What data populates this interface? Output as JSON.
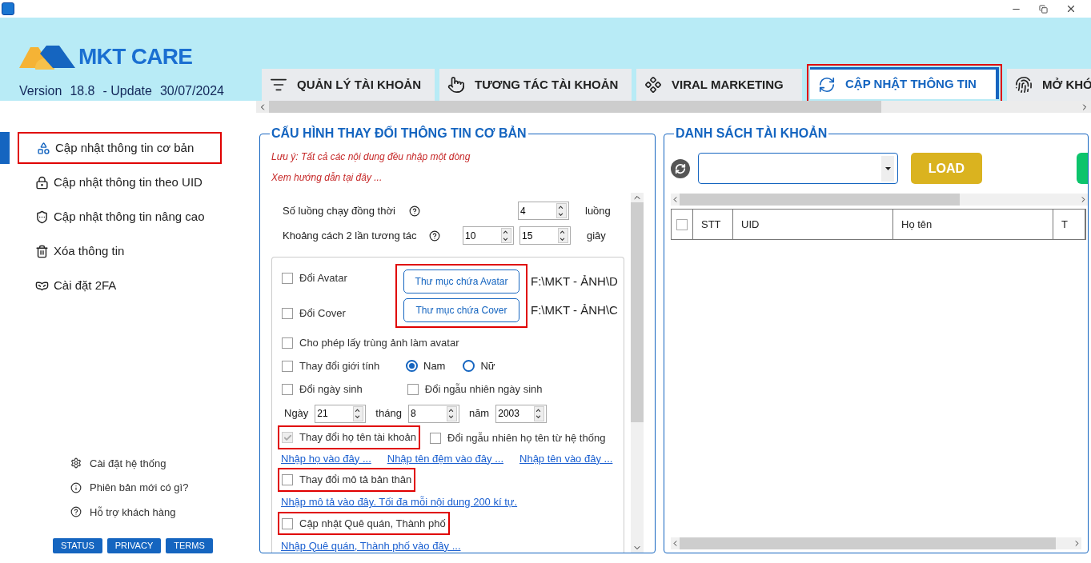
{
  "app": {
    "logo_text": "MKT CARE",
    "version_label": "Version",
    "version": "18.8",
    "update_label": "- Update",
    "update_date": "30/07/2024"
  },
  "tabs": [
    {
      "label": "QUẢN LÝ TÀI KHOẢN",
      "selected": false,
      "highlighted": false
    },
    {
      "label": "TƯƠNG TÁC TÀI KHOẢN",
      "selected": false,
      "highlighted": false
    },
    {
      "label": "VIRAL MARKETING",
      "selected": false,
      "highlighted": false
    },
    {
      "label": "CẬP NHẬT THÔNG TIN",
      "selected": true,
      "highlighted": true
    },
    {
      "label": "MỞ KHÓ",
      "selected": false,
      "highlighted": false
    }
  ],
  "sidebar": {
    "items": [
      {
        "label": "Cập nhật thông tin cơ bản",
        "selected": true,
        "highlighted": true
      },
      {
        "label": "Cập nhật thông tin theo UID",
        "selected": false,
        "highlighted": false
      },
      {
        "label": "Cập nhật thông tin nâng cao",
        "selected": false,
        "highlighted": false
      },
      {
        "label": "Xóa thông tin",
        "selected": false,
        "highlighted": false
      },
      {
        "label": "Cài đặt 2FA",
        "selected": false,
        "highlighted": false
      }
    ],
    "links": [
      "Cài đặt hệ thống",
      "Phiên bản mới có gì?",
      "Hỗ trợ khách hàng"
    ],
    "buttons": [
      "STATUS",
      "PRIVACY",
      "TERMS"
    ]
  },
  "config": {
    "title": "CẤU HÌNH THAY ĐỔI THÔNG TIN CƠ BẢN",
    "notes": [
      "Lưu ý: Tất cả các nội dung đều nhập một dòng",
      "Xem hướng dẫn tại đây ..."
    ],
    "threads": {
      "label": "Số luồng chạy đồng thời",
      "value": "4",
      "unit": "luồng"
    },
    "interval": {
      "label": "Khoảng cách 2 lần tương tác",
      "from": "10",
      "to": "15",
      "unit": "giây"
    },
    "folders": {
      "highlighted": true,
      "rows": [
        {
          "label": "Đổi Avatar",
          "checked": false,
          "button": "Thư mục chứa Avatar",
          "path": "F:\\MKT - ẢNH\\D"
        },
        {
          "label": "Đổi Cover",
          "checked": false,
          "button": "Thư mục chứa Cover",
          "path": "F:\\MKT - ẢNH\\C"
        }
      ]
    },
    "options": [
      {
        "kind": "check",
        "checks": [
          {
            "label": "Cho phép lấy trùng ảnh làm avatar",
            "checked": false,
            "disabled": false,
            "highlighted": false
          }
        ]
      },
      {
        "kind": "gender",
        "checks": [
          {
            "label": "Thay đổi giới tính",
            "checked": false,
            "disabled": false,
            "highlighted": false
          }
        ],
        "radios": [
          {
            "label": "Nam",
            "selected": true
          },
          {
            "label": "Nữ",
            "selected": false
          }
        ]
      },
      {
        "kind": "check",
        "checks": [
          {
            "label": "Đổi ngày sinh",
            "checked": false,
            "disabled": false,
            "highlighted": false
          },
          {
            "label": "Đổi ngẫu nhiên ngày sinh",
            "checked": false,
            "disabled": false,
            "highlighted": false
          }
        ]
      },
      {
        "kind": "date",
        "fields": [
          {
            "label": "Ngày",
            "value": "21"
          },
          {
            "label": "tháng",
            "value": "8"
          },
          {
            "label": "năm",
            "value": "2003"
          }
        ]
      },
      {
        "kind": "check",
        "checks": [
          {
            "label": "Thay đổi họ tên tài khoản",
            "checked": true,
            "disabled": true,
            "highlighted": true
          },
          {
            "label": "Đổi ngẫu nhiên họ tên từ hệ thống",
            "checked": false,
            "disabled": false,
            "highlighted": false
          }
        ],
        "links": [
          "Nhập họ vào đây ...",
          "Nhập tên đệm vào đây ...",
          "Nhập tên vào đây ..."
        ]
      },
      {
        "kind": "check",
        "checks": [
          {
            "label": "Thay đổi mô tả bản thân",
            "checked": false,
            "disabled": false,
            "highlighted": true
          }
        ],
        "links": [
          "Nhập mô tả vào đây. Tối đa mỗi nội dung 200 kí tự."
        ]
      },
      {
        "kind": "check",
        "checks": [
          {
            "label": "Cập nhật Quê quán, Thành phố",
            "checked": false,
            "disabled": false,
            "highlighted": true
          }
        ],
        "links": [
          "Nhập Quê quán, Thành phố vào đây ..."
        ]
      }
    ]
  },
  "accounts": {
    "title": "DANH SÁCH TÀI KHOẢN",
    "load_button": "LOAD",
    "columns": [
      "STT",
      "UID",
      "Họ tên",
      "T"
    ],
    "select_all_checked": false
  }
}
